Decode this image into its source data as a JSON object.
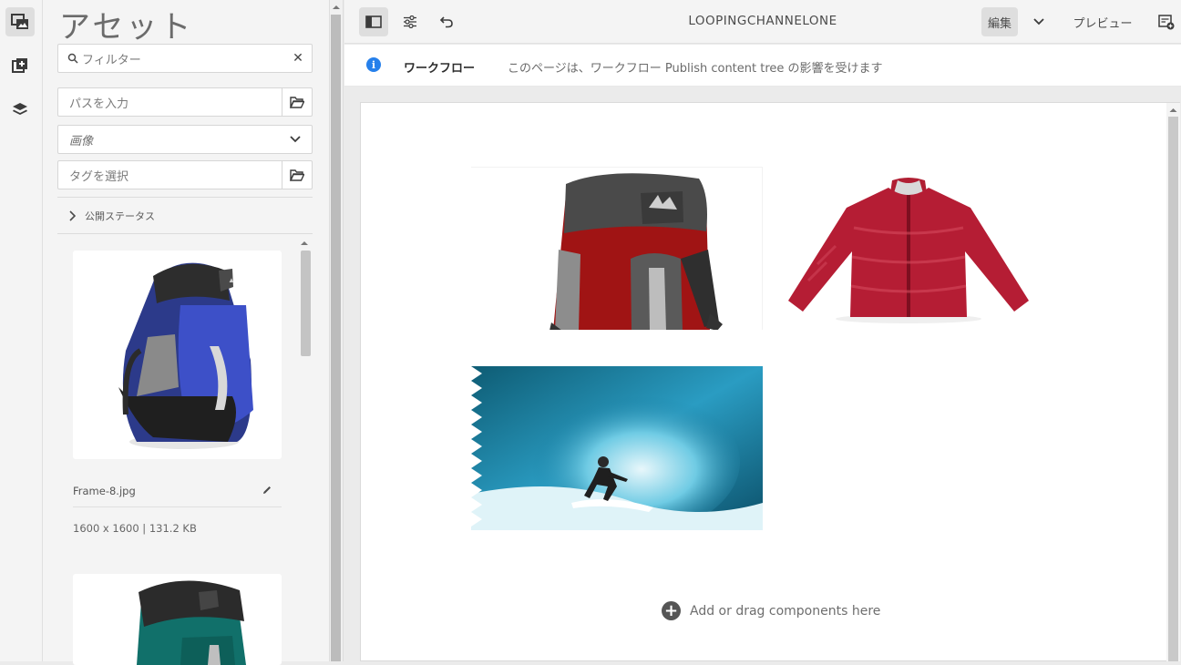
{
  "rail": {
    "items": [
      {
        "icon": "asset-finder-icon",
        "active": true
      },
      {
        "icon": "components-add-icon",
        "active": false
      },
      {
        "icon": "layers-icon",
        "active": false
      }
    ]
  },
  "panel": {
    "title": "アセット",
    "filter_placeholder": "フィルター",
    "path_placeholder": "パスを入力",
    "type_select": "画像",
    "tag_placeholder": "タグを選択",
    "publish_status_label": "公開ステータス",
    "assets": [
      {
        "name": "Frame-8.jpg",
        "meta": "1600 x 1600 | 131.2 KB",
        "image": "blue-backpack"
      },
      {
        "name": "",
        "meta": "",
        "image": "green-backpack"
      }
    ]
  },
  "toolbar": {
    "page_title": "LOOPINGCHANNELONE",
    "mode_label": "編集",
    "preview_label": "プレビュー"
  },
  "infobar": {
    "title": "ワークフロー",
    "message": "このページは、ワークフロー Publish content tree の影響を受けます"
  },
  "canvas": {
    "add_components_label": "Add or drag components here",
    "images": [
      "red-backpack",
      "red-jacket",
      "surfer-wave"
    ]
  },
  "colors": {
    "accent": "#2680eb",
    "panel_bg": "#f4f4f4"
  }
}
